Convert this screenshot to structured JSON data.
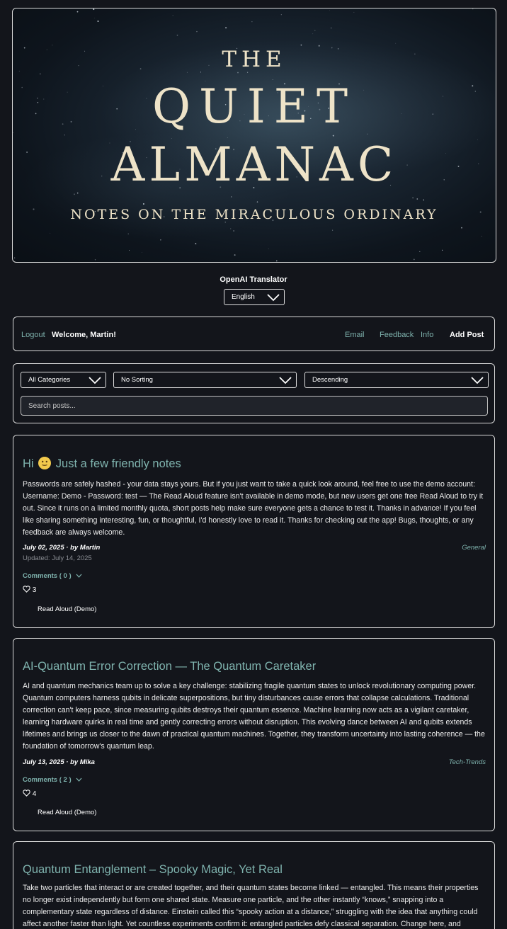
{
  "hero": {
    "line1": "THE",
    "line2": "QUIET",
    "line3": "ALMANAC",
    "subtitle": "NOTES ON THE MIRACULOUS ORDINARY"
  },
  "translator": {
    "label": "OpenAI Translator",
    "selected": "English"
  },
  "nav": {
    "logout": "Logout",
    "welcome": "Welcome, Martin!",
    "email": "Email",
    "feedback": "Feedback",
    "info": "Info",
    "add_post": "Add Post"
  },
  "filters": {
    "category": "All Categories",
    "sorting": "No Sorting",
    "order": "Descending",
    "search_placeholder": "Search posts..."
  },
  "posts": [
    {
      "title_pre": "Hi",
      "title_post": "Just a few friendly notes",
      "body": "Passwords are safely hashed - your data stays yours. But if you just want to take a quick look around, feel free to use the demo account: Username: Demo - Password: test — The Read Aloud feature isn't available in demo mode, but new users get one free Read Aloud to try it out. Since it runs on a limited monthly quota, short posts help make sure everyone gets a chance to test it. Thanks in advance! If you feel like sharing something interesting, fun, or thoughtful, I'd honestly love to read it. Thanks for checking out the app! Bugs, thoughts, or any feedback are always welcome.",
      "meta": "July 02, 2025 · by Martin",
      "category": "General",
      "updated": "Updated: July 14, 2025",
      "comments": "Comments ( 0 )",
      "likes": "3",
      "read_aloud": "Read Aloud (Demo)"
    },
    {
      "title": "AI-Quantum Error Correction — The Quantum Caretaker",
      "body": "AI and quantum mechanics team up to solve a key challenge: stabilizing fragile quantum states to unlock revolutionary computing power. Quantum computers harness qubits in delicate superpositions, but tiny disturbances cause errors that collapse calculations. Traditional correction can't keep pace, since measuring qubits destroys their quantum essence. Machine learning now acts as a vigilant caretaker, learning hardware quirks in real time and gently correcting errors without disruption. This evolving dance between AI and qubits extends lifetimes and brings us closer to the dawn of practical quantum machines. Together, they transform uncertainty into lasting coherence — the foundation of tomorrow's quantum leap.",
      "meta": "July 13, 2025 · by Mika",
      "category": "Tech-Trends",
      "comments": "Comments ( 2 )",
      "likes": "4",
      "read_aloud": "Read Aloud (Demo)"
    },
    {
      "title": "Quantum Entanglement – Spooky Magic, Yet Real",
      "body": "Take two particles that interact or are created together, and their quantum states become linked — entangled. This means their properties no longer exist independently but form one shared state. Measure one particle, and the other instantly “knows,” snapping into a complementary state regardless of distance. Einstein called this “spooky action at a distance,” struggling with the idea that anything could affect another faster than light. Yet countless experiments confirm it: entangled particles defy classical separation. Change here, and"
    }
  ]
}
